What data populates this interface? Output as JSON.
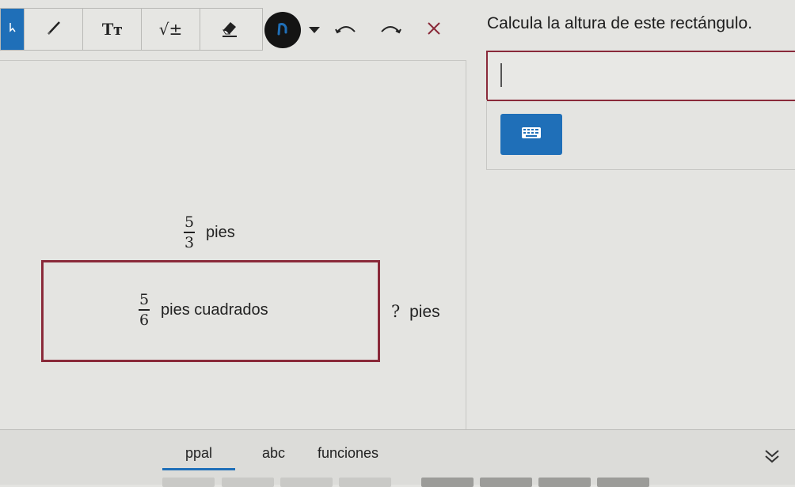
{
  "toolbar": {
    "tools": [
      {
        "name": "select-tool",
        "icon": "pointer-icon"
      },
      {
        "name": "pencil-tool",
        "icon": "pencil-icon"
      },
      {
        "name": "text-tool",
        "label": "Tт"
      },
      {
        "name": "math-tool",
        "label": "√±"
      },
      {
        "name": "eraser-tool",
        "icon": "eraser-icon"
      }
    ],
    "pen_color": "#141414",
    "accent": "#1f6fb8"
  },
  "question": {
    "text": "Calcula la altura de este rectángulo."
  },
  "figure": {
    "width": {
      "numerator": "5",
      "denominator": "3",
      "unit": "pies"
    },
    "area": {
      "numerator": "5",
      "denominator": "6",
      "unit": "pies cuadrados"
    },
    "height": {
      "value": "?",
      "unit": "pies"
    },
    "border_color": "#8a2a3a"
  },
  "tabs": {
    "items": [
      {
        "label": "ppal",
        "active": true
      },
      {
        "label": "abc",
        "active": false
      },
      {
        "label": "funciones",
        "active": false
      }
    ]
  }
}
